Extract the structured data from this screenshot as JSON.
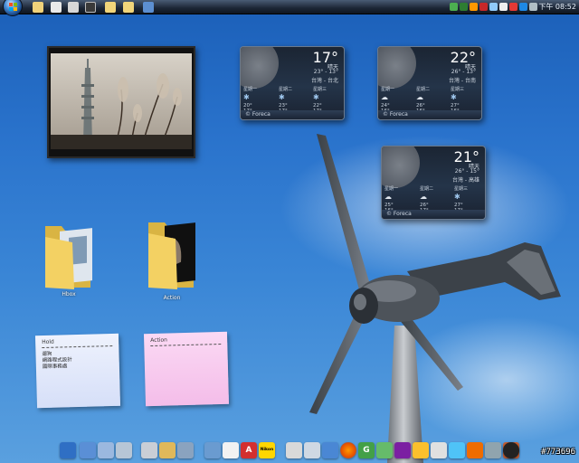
{
  "taskbar": {
    "clock": "下午 08:52",
    "quick_launch": [
      "show-desktop-icon",
      "folder-icon",
      "media-icon",
      "hd-icon",
      "dvd-icon",
      "folder-icon",
      "document-icon",
      "app-icon"
    ],
    "tray": [
      "network-icon",
      "volume-icon",
      "chat-icon",
      "shield-icon",
      "update-icon",
      "flag-icon",
      "sound-icon",
      "power-icon",
      "monitor-icon"
    ]
  },
  "weather": [
    {
      "temp": "17°",
      "desc": "晴天",
      "range": "23° - 13°",
      "city": "台灣 - 台北",
      "forecast": [
        {
          "day": "星期一",
          "hi": "20°",
          "lo": "17°",
          "icon": "snow-icon"
        },
        {
          "day": "星期二",
          "hi": "23°",
          "lo": "17°",
          "icon": "snow-icon"
        },
        {
          "day": "星期三",
          "hi": "22°",
          "lo": "17°",
          "icon": "snow-icon"
        }
      ],
      "brand": "© Foreca"
    },
    {
      "temp": "22°",
      "desc": "晴天",
      "range": "26° - 13°",
      "city": "台灣 - 台南",
      "forecast": [
        {
          "day": "星期一",
          "hi": "24°",
          "lo": "16°",
          "icon": "cloud-icon"
        },
        {
          "day": "星期二",
          "hi": "26°",
          "lo": "16°",
          "icon": "cloud-icon"
        },
        {
          "day": "星期三",
          "hi": "27°",
          "lo": "16°",
          "icon": "snow-icon"
        }
      ],
      "brand": "© Foreca"
    },
    {
      "temp": "21°",
      "desc": "晴天",
      "range": "26° - 15°",
      "city": "台灣 - 高雄",
      "forecast": [
        {
          "day": "星期一",
          "hi": "25°",
          "lo": "16°",
          "icon": "cloud-icon"
        },
        {
          "day": "星期二",
          "hi": "26°",
          "lo": "17°",
          "icon": "cloud-icon"
        },
        {
          "day": "星期三",
          "hi": "27°",
          "lo": "17°",
          "icon": "snow-icon"
        }
      ],
      "brand": "© Foreca"
    }
  ],
  "folders": [
    {
      "label": "Hbox"
    },
    {
      "label": "Action"
    }
  ],
  "notes": {
    "hold": {
      "title": "Hold",
      "lines": [
        "遛狗",
        "網路程式設計",
        "國際事務處"
      ]
    },
    "action": {
      "title": "Action",
      "lines": []
    }
  },
  "dock": {
    "icons": [
      "monitor-icon",
      "network-icon",
      "explorer-icon",
      "recycle-bin-icon",
      "media-icon",
      "folder-icon",
      "tools-icon",
      "globe-icon",
      "clock-icon",
      "adobe-icon",
      "nikon-icon",
      "blank-icon",
      "calculator-icon",
      "mail-icon",
      "firefox-icon",
      "chrome-icon",
      "green-app-icon",
      "yahoo-icon",
      "star-icon",
      "puzzle-icon",
      "folder-icon",
      "lightning-icon",
      "download-icon",
      "skype-icon",
      "box-icon",
      "pinwheel-icon"
    ],
    "adobe_label": "A",
    "nikon_label": "Nikon",
    "g_label": "G"
  },
  "watermark": "#773696",
  "colors": {
    "desktop_top": "#1b5fb8",
    "desktop_bottom": "#5aa0df",
    "note_blue": "#dde6fb",
    "note_pink": "#f7c6ee",
    "folder_yellow": "#f3d163"
  }
}
